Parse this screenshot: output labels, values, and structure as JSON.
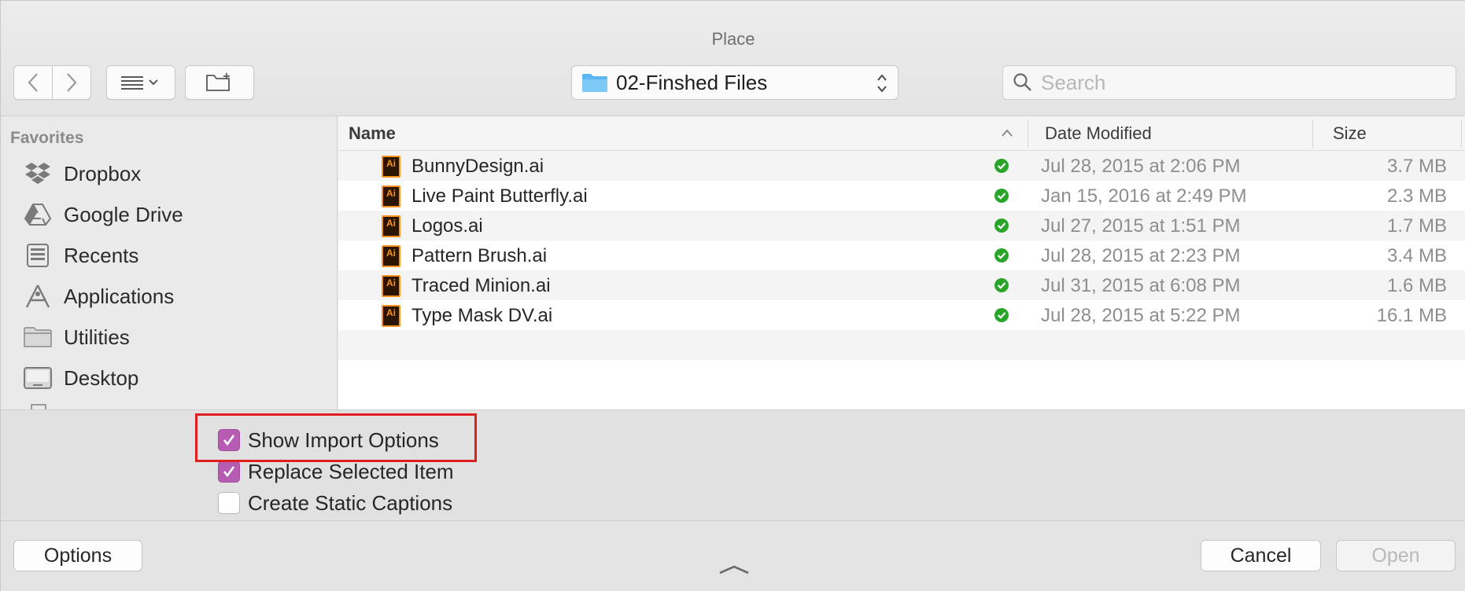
{
  "window": {
    "title": "Place"
  },
  "toolbar": {
    "path_label": "02-Finshed Files",
    "search_placeholder": "Search"
  },
  "sidebar": {
    "heading": "Favorites",
    "items": [
      {
        "label": "Dropbox",
        "icon": "dropbox-icon"
      },
      {
        "label": "Google Drive",
        "icon": "google-drive-icon"
      },
      {
        "label": "Recents",
        "icon": "recents-icon"
      },
      {
        "label": "Applications",
        "icon": "applications-icon"
      },
      {
        "label": "Utilities",
        "icon": "folder-icon"
      },
      {
        "label": "Desktop",
        "icon": "desktop-icon"
      }
    ]
  },
  "columns": {
    "name": "Name",
    "date": "Date Modified",
    "size": "Size"
  },
  "files": [
    {
      "name": "BunnyDesign.ai",
      "date": "Jul 28, 2015 at 2:06 PM",
      "size": "3.7 MB"
    },
    {
      "name": "Live Paint Butterfly.ai",
      "date": "Jan 15, 2016 at 2:49 PM",
      "size": "2.3 MB"
    },
    {
      "name": "Logos.ai",
      "date": "Jul 27, 2015 at 1:51 PM",
      "size": "1.7 MB"
    },
    {
      "name": "Pattern Brush.ai",
      "date": "Jul 28, 2015 at 2:23 PM",
      "size": "3.4 MB"
    },
    {
      "name": "Traced Minion.ai",
      "date": "Jul 31, 2015 at 6:08 PM",
      "size": "1.6 MB"
    },
    {
      "name": "Type Mask DV.ai",
      "date": "Jul 28, 2015 at 5:22 PM",
      "size": "16.1 MB"
    }
  ],
  "file_icon_text": "Ai",
  "options": [
    {
      "label": "Show Import Options",
      "checked": true
    },
    {
      "label": "Replace Selected Item",
      "checked": true
    },
    {
      "label": "Create Static Captions",
      "checked": false
    }
  ],
  "buttons": {
    "options": "Options",
    "cancel": "Cancel",
    "open": "Open"
  },
  "colors": {
    "checkbox_accent": "#b65db3",
    "highlight_box": "#e02020",
    "sync_check": "#2aa52a",
    "ai_icon": "#f7931e"
  }
}
